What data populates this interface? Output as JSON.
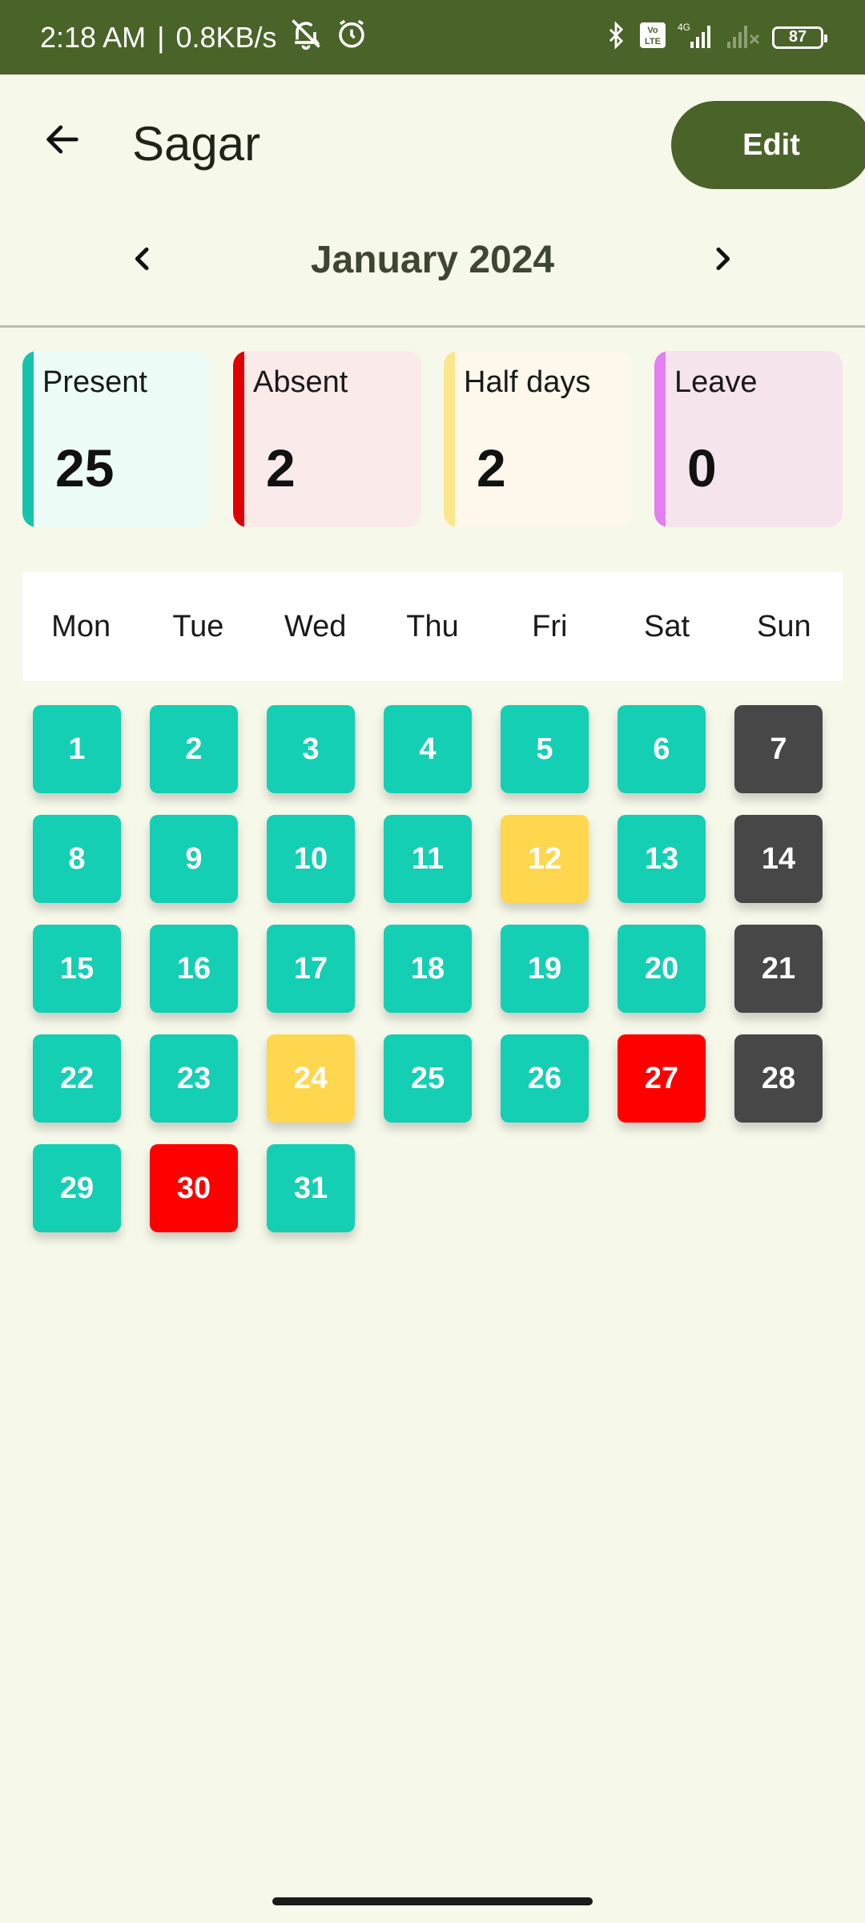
{
  "status_bar": {
    "time": "2:18 AM",
    "separator": "|",
    "speed": "0.8KB/s",
    "icons": [
      "muted-bell-icon",
      "alarm-icon",
      "bluetooth-icon",
      "volte-icon",
      "signal-4g-icon",
      "signal-no-service-icon"
    ],
    "volte_text": "Vo LTE",
    "network_text": "4G",
    "battery": "87"
  },
  "header": {
    "back_icon": "arrow-left-icon",
    "title": "Sagar",
    "edit_label": "Edit"
  },
  "month_nav": {
    "prev_icon": "chevron-left-icon",
    "label": "January 2024",
    "next_icon": "chevron-right-icon"
  },
  "summary": [
    {
      "label": "Present",
      "value": "25",
      "stripe": "#17c3ad",
      "bg": "#edfcf6"
    },
    {
      "label": "Absent",
      "value": "2",
      "stripe": "#e00000",
      "bg": "#fbeaea"
    },
    {
      "label": "Half days",
      "value": "2",
      "stripe": "#fde68a",
      "bg": "#fdf7ec"
    },
    {
      "label": "Leave",
      "value": "0",
      "stripe": "#e37ff0",
      "bg": "#f5e4ee"
    }
  ],
  "weekdays": [
    "Mon",
    "Tue",
    "Wed",
    "Thu",
    "Fri",
    "Sat",
    "Sun"
  ],
  "status_colors": {
    "present": "#14cfb3",
    "absent": "#ff0000",
    "half": "#ffd74f",
    "holiday": "#474747"
  },
  "days": [
    {
      "day": "1",
      "status": "present"
    },
    {
      "day": "2",
      "status": "present"
    },
    {
      "day": "3",
      "status": "present"
    },
    {
      "day": "4",
      "status": "present"
    },
    {
      "day": "5",
      "status": "present"
    },
    {
      "day": "6",
      "status": "present"
    },
    {
      "day": "7",
      "status": "holiday"
    },
    {
      "day": "8",
      "status": "present"
    },
    {
      "day": "9",
      "status": "present"
    },
    {
      "day": "10",
      "status": "present"
    },
    {
      "day": "11",
      "status": "present"
    },
    {
      "day": "12",
      "status": "half"
    },
    {
      "day": "13",
      "status": "present"
    },
    {
      "day": "14",
      "status": "holiday"
    },
    {
      "day": "15",
      "status": "present"
    },
    {
      "day": "16",
      "status": "present"
    },
    {
      "day": "17",
      "status": "present"
    },
    {
      "day": "18",
      "status": "present"
    },
    {
      "day": "19",
      "status": "present"
    },
    {
      "day": "20",
      "status": "present"
    },
    {
      "day": "21",
      "status": "holiday"
    },
    {
      "day": "22",
      "status": "present"
    },
    {
      "day": "23",
      "status": "present"
    },
    {
      "day": "24",
      "status": "half"
    },
    {
      "day": "25",
      "status": "present"
    },
    {
      "day": "26",
      "status": "present"
    },
    {
      "day": "27",
      "status": "absent"
    },
    {
      "day": "28",
      "status": "holiday"
    },
    {
      "day": "29",
      "status": "present"
    },
    {
      "day": "30",
      "status": "absent"
    },
    {
      "day": "31",
      "status": "present"
    }
  ]
}
